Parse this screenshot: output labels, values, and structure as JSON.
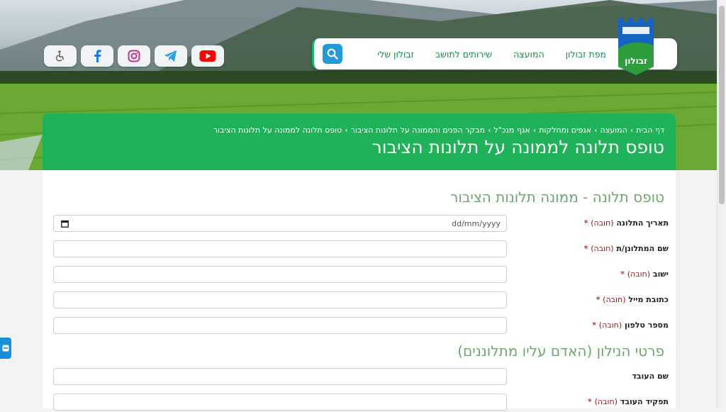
{
  "header": {
    "nav_items": [
      "מפת זבולון",
      "המועצה",
      "שירותים לתושב",
      "זבולון שלי"
    ],
    "logo_text": "זבולון",
    "social_icons": [
      "accessibility-icon",
      "facebook-icon",
      "instagram-icon",
      "telegram-icon",
      "youtube-icon"
    ]
  },
  "band": {
    "breadcrumbs": [
      "דף הבית",
      "המועצה",
      "אגפים ומחלקות",
      "אגף מנכ\"ל",
      "מבקר הפנים והממונה על תלונות הציבור",
      "טופס תלונה לממונה על תלונות הציבור"
    ],
    "separator": "›",
    "title": "טופס תלונה לממונה על תלונות הציבור"
  },
  "form": {
    "section1_title": "טופס תלונה - ממונה תלונות הציבור",
    "section2_title": "פרטי הנילון (האדם עליו מתלוננים)",
    "required_text": "(חובה)",
    "star": "*",
    "date_placeholder": "dd/mm/yyyy",
    "fields1": [
      {
        "label": "תאריך התלונה",
        "required": true
      },
      {
        "label": "שם המתלונן/ת",
        "required": true
      },
      {
        "label": "ישוב",
        "required": true
      },
      {
        "label": "כתובת מייל",
        "required": true
      },
      {
        "label": "מספר טלפון",
        "required": true
      }
    ],
    "fields2": [
      {
        "label": "שם העובד",
        "required": false
      },
      {
        "label": "תפקיד העובד",
        "required": true
      }
    ]
  },
  "colors": {
    "brand_green": "#1fb259",
    "nav_text": "#1d8a4a",
    "section_title": "#6fa76f",
    "search_blue": "#2299d8"
  }
}
